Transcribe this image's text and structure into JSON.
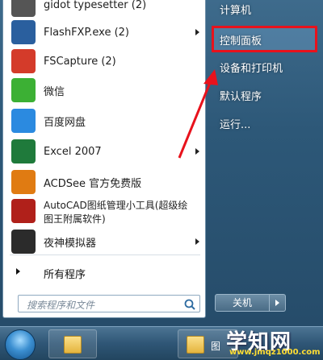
{
  "start_menu": {
    "programs": [
      {
        "label": "gidot typesetter (2)",
        "icon": "gidot-icon",
        "color": "#555555",
        "has_arrow": false
      },
      {
        "label": "FlashFXP.exe (2)",
        "icon": "flashfxp-icon",
        "color": "#2a5f9e",
        "has_arrow": true
      },
      {
        "label": "FSCapture (2)",
        "icon": "fscapture-icon",
        "color": "#d43b2a",
        "has_arrow": false
      },
      {
        "label": "微信",
        "icon": "wechat-icon",
        "color": "#3cb034",
        "has_arrow": false
      },
      {
        "label": "百度网盘",
        "icon": "baidu-netdisk-icon",
        "color": "#2b8ae0",
        "has_arrow": false
      },
      {
        "label": "Excel 2007",
        "icon": "excel-icon",
        "color": "#1f7a3b",
        "has_arrow": true
      },
      {
        "label": "ACDSee 官方免费版",
        "icon": "acdsee-icon",
        "color": "#e07b12",
        "has_arrow": false
      },
      {
        "label": "AutoCAD图纸管理小工具(超级绘",
        "label2": "图王附属软件)",
        "icon": "autocad-tool-icon",
        "color": "#b0201a",
        "has_arrow": false
      },
      {
        "label": "夜神模拟器",
        "icon": "nox-icon",
        "color": "#2b2b2b",
        "has_arrow": true
      }
    ],
    "all_programs_label": "所有程序",
    "search": {
      "placeholder": "搜索程序和文件"
    },
    "right_items": [
      {
        "label": "计算机"
      },
      {
        "label": "控制面板"
      },
      {
        "label": "设备和打印机"
      },
      {
        "label": "默认程序"
      },
      {
        "label": "运行..."
      }
    ],
    "shutdown_label": "关机"
  },
  "taskbar": {
    "items": [
      {
        "icon": "start-orb-icon"
      },
      {
        "icon": "folder-icon"
      },
      {
        "icon": "folder-icon",
        "text": "图"
      }
    ]
  },
  "watermark": {
    "big": "学知网",
    "small": "www.jmqz1000.com"
  },
  "colors": {
    "highlight_border": "#e8121c",
    "annotation_arrow": "#e8121c"
  }
}
